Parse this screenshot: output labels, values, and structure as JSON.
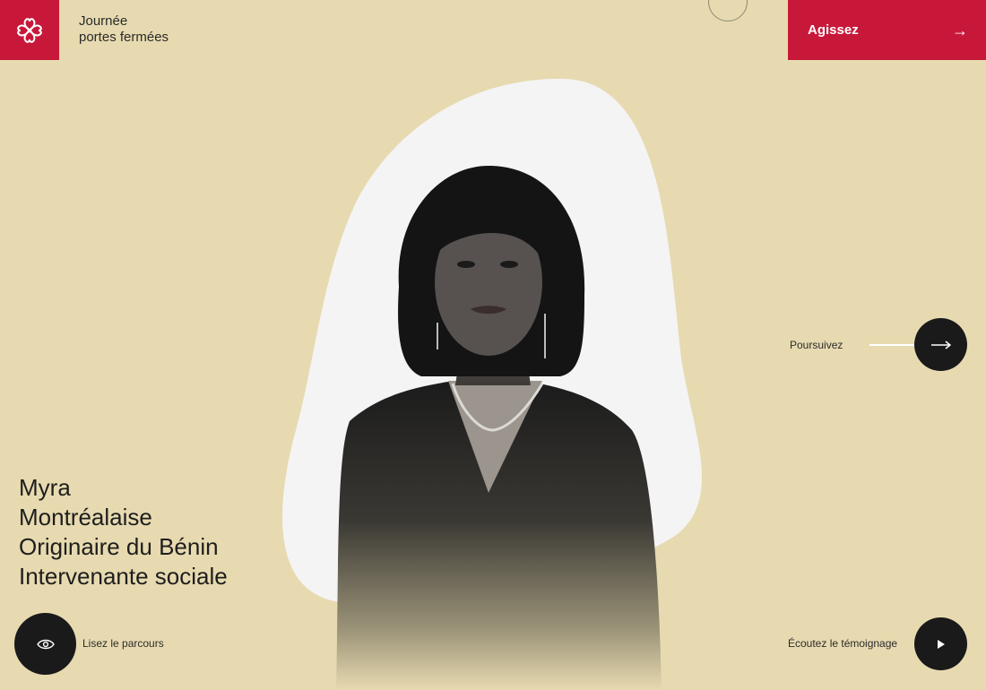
{
  "header": {
    "title_line1": "Journée",
    "title_line2": "portes fermées",
    "cta_label": "Agissez",
    "cta_arrow": "→"
  },
  "profile": {
    "name": "Myra",
    "residence": "Montréalaise",
    "origin": "Originaire du Bénin",
    "occupation": "Intervenante sociale"
  },
  "actions": {
    "next_label": "Poursuivez",
    "read_label": "Lisez le parcours",
    "listen_label": "Écoutez le témoignage"
  },
  "colors": {
    "background": "#e7dab0",
    "accent": "#c8183a",
    "blob": "#f4f4f4",
    "button": "#1a1a1a"
  },
  "icons": {
    "logo": "montreal-rosette-icon",
    "arrow": "arrow-right-icon",
    "eye": "eye-icon",
    "play": "play-icon"
  }
}
